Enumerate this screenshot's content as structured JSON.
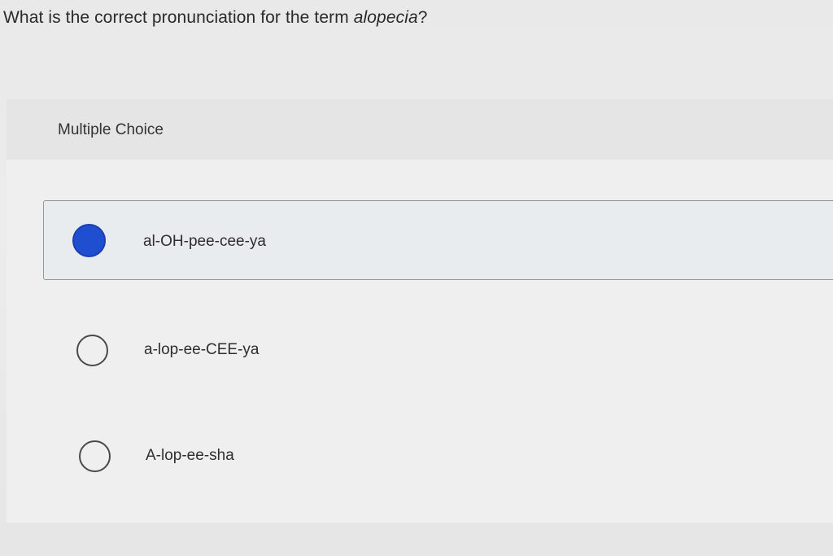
{
  "question": {
    "prefix": "What is the correct pronunciation for the term ",
    "term": "alopecia",
    "suffix": "?"
  },
  "panel": {
    "type_label": "Multiple Choice"
  },
  "options": [
    {
      "label": "al-OH-pee-cee-ya",
      "selected": true
    },
    {
      "label": "a-lop-ee-CEE-ya",
      "selected": false
    },
    {
      "label": "A-lop-ee-sha",
      "selected": false
    }
  ],
  "colors": {
    "accent": "#1f4fd0",
    "selected_background": "#e9ecef"
  }
}
